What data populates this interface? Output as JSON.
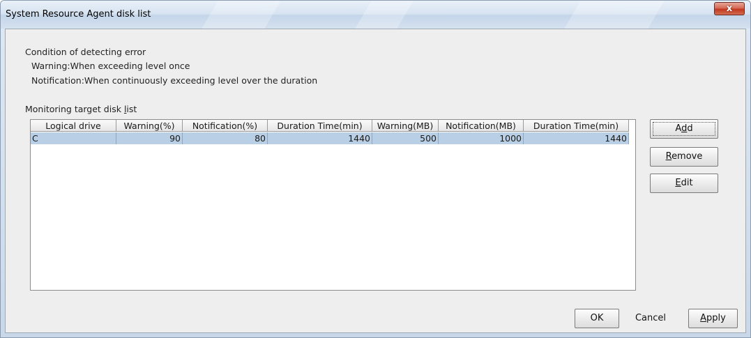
{
  "window": {
    "title": "System Resource Agent disk list",
    "close_label": "x"
  },
  "condition": {
    "heading": "Condition of detecting error",
    "warning": "Warning:When exceeding level once",
    "notification": "Notification:When continuously exceeding level over the duration"
  },
  "list": {
    "label_pre": "Monitoring target disk ",
    "label_mnemonic": "l",
    "label_post": "ist",
    "columns": [
      "Logical drive",
      "Warning(%)",
      "Notification(%)",
      "Duration Time(min)",
      "Warning(MB)",
      "Notification(MB)",
      "Duration Time(min)"
    ],
    "rows": [
      [
        "C",
        "90",
        "80",
        "1440",
        "500",
        "1000",
        "1440"
      ]
    ],
    "selected_row": 0
  },
  "side_buttons": {
    "add": {
      "pre": "A",
      "mnemonic": "d",
      "post": "d"
    },
    "remove": {
      "pre": "",
      "mnemonic": "R",
      "post": "emove"
    },
    "edit": {
      "pre": "",
      "mnemonic": "E",
      "post": "dit"
    }
  },
  "footer_buttons": {
    "ok": "OK",
    "cancel": "Cancel",
    "apply": {
      "pre": "",
      "mnemonic": "A",
      "post": "pply"
    }
  },
  "colors": {
    "selection": "#b8cfe5",
    "close_button": "#c2381f"
  }
}
